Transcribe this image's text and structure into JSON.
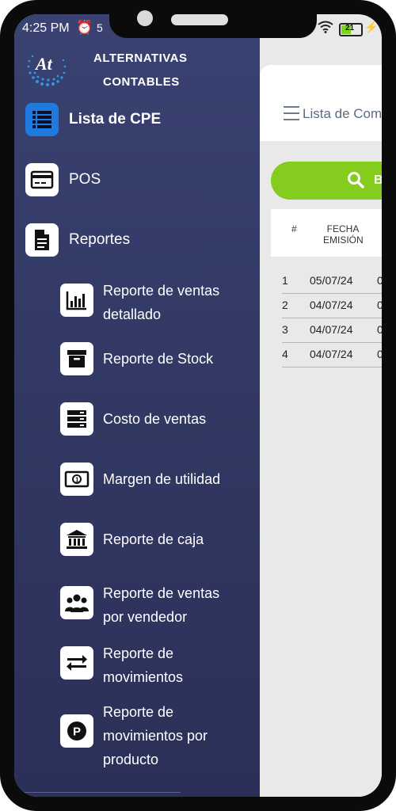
{
  "status_bar": {
    "time": "4:25 PM",
    "alarm_icon": "alarm-icon",
    "extra_icon": "5",
    "battery": "21"
  },
  "drawer": {
    "brand_line1": "ALTERNATIVAS",
    "brand_line2": "CONTABLES",
    "items": [
      {
        "label": "Lista de CPE",
        "icon": "list-icon"
      },
      {
        "label": "POS",
        "icon": "card-icon"
      },
      {
        "label": "Reportes",
        "icon": "document-icon"
      }
    ],
    "reports": [
      {
        "line1": "Reporte de ventas",
        "line2": "detallado",
        "icon": "bar-chart-icon"
      },
      {
        "line1": "Reporte de Stock",
        "icon": "archive-box-icon"
      },
      {
        "line1": "Costo de ventas",
        "icon": "server-icon"
      },
      {
        "line1": "Margen de utilidad",
        "icon": "money-bill-icon"
      },
      {
        "line1": "Reporte de caja",
        "icon": "bank-icon"
      },
      {
        "line1": "Reporte de ventas",
        "line2": "por vendedor",
        "icon": "users-icon"
      },
      {
        "line1": "Reporte de",
        "line2": "movimientos",
        "icon": "exchange-arrows-icon"
      },
      {
        "line1": "Reporte de",
        "line2": "movimientos por",
        "line3": "producto",
        "icon": "parking-p-icon"
      }
    ]
  },
  "main": {
    "title": "Lista de Com",
    "search_button_label": "B",
    "table": {
      "headers": [
        "#",
        "FECHA EMISIÓN"
      ],
      "header_fecha_line1": "FECHA",
      "header_fecha_line2": "EMISIÓN",
      "rows": [
        {
          "num": "1",
          "fecha": "05/07/24",
          "next": "0"
        },
        {
          "num": "2",
          "fecha": "04/07/24",
          "next": "0"
        },
        {
          "num": "3",
          "fecha": "04/07/24",
          "next": "0"
        },
        {
          "num": "4",
          "fecha": "04/07/24",
          "next": "0"
        }
      ]
    }
  },
  "colors": {
    "drawer_bg": "#323964",
    "button_green": "#84cc1e",
    "list_icon_blue": "#1f7ae0"
  }
}
